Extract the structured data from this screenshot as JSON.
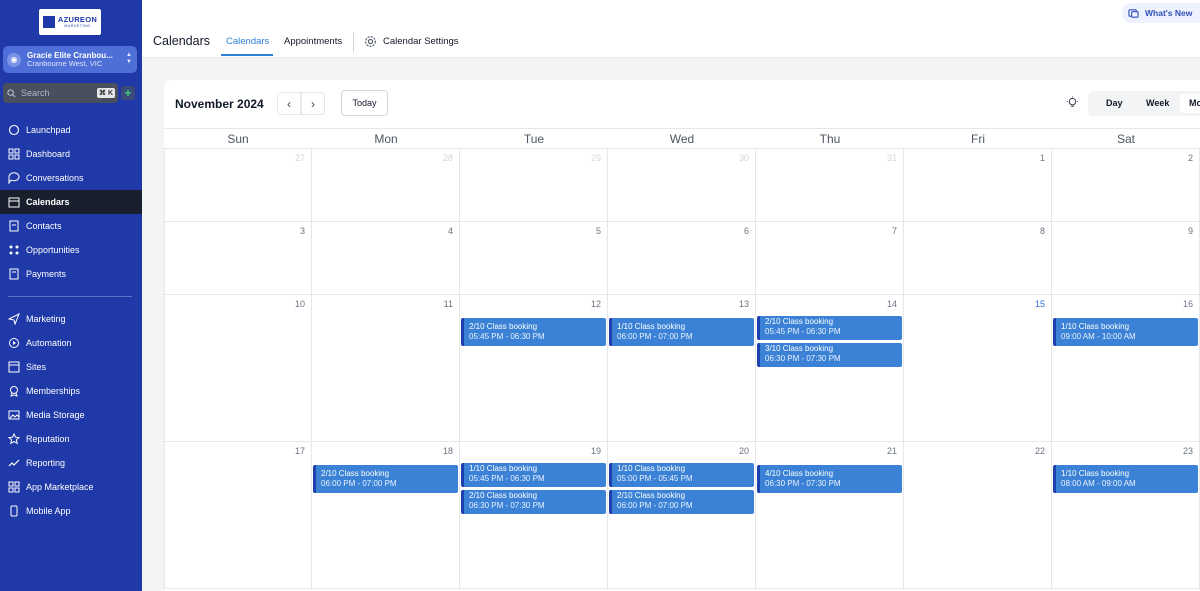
{
  "sidebar": {
    "logo": {
      "name": "AZUREON",
      "sub": "MARKETING"
    },
    "account": {
      "name": "Gracie Elite Cranbou...",
      "location": "Cranbourne West, VIC"
    },
    "search": {
      "placeholder": "Search",
      "shortcut": "⌘ K"
    },
    "nav_top": [
      "Launchpad",
      "Dashboard",
      "Conversations",
      "Calendars",
      "Contacts",
      "Opportunities",
      "Payments"
    ],
    "nav_bottom": [
      "Marketing",
      "Automation",
      "Sites",
      "Memberships",
      "Media Storage",
      "Reputation",
      "Reporting",
      "App Marketplace",
      "Mobile App"
    ],
    "active": "Calendars"
  },
  "topbar": {
    "title": "Calendars",
    "tabs": [
      "Calendars",
      "Appointments",
      "Calendar Settings"
    ],
    "active_tab": "Calendars",
    "whats_new": "What's New"
  },
  "calendar": {
    "month_label": "November 2024",
    "today_button": "Today",
    "views": [
      "Day",
      "Week",
      "Mo"
    ],
    "active_view": "Mo",
    "weekdays": [
      "Sun",
      "Mon",
      "Tue",
      "Wed",
      "Thu",
      "Fri",
      "Sat"
    ],
    "weeks": [
      [
        {
          "d": "27",
          "muted": true
        },
        {
          "d": "28",
          "muted": true
        },
        {
          "d": "29",
          "muted": true
        },
        {
          "d": "30",
          "muted": true
        },
        {
          "d": "31",
          "muted": true
        },
        {
          "d": "1"
        },
        {
          "d": "2"
        }
      ],
      [
        {
          "d": "3"
        },
        {
          "d": "4"
        },
        {
          "d": "5"
        },
        {
          "d": "6"
        },
        {
          "d": "7"
        },
        {
          "d": "8"
        },
        {
          "d": "9"
        }
      ],
      [
        {
          "d": "10"
        },
        {
          "d": "11"
        },
        {
          "d": "12"
        },
        {
          "d": "13"
        },
        {
          "d": "14"
        },
        {
          "d": "15",
          "today": true
        },
        {
          "d": "16"
        }
      ],
      [
        {
          "d": "17"
        },
        {
          "d": "18"
        },
        {
          "d": "19"
        },
        {
          "d": "20"
        },
        {
          "d": "21"
        },
        {
          "d": "22"
        },
        {
          "d": "23"
        }
      ]
    ],
    "events": [
      {
        "week": 2,
        "day": 2,
        "slot": 0,
        "title": "2/10  Class booking",
        "time": "05:45 PM - 06:30 PM"
      },
      {
        "week": 2,
        "day": 3,
        "slot": 0,
        "title": "1/10  Class booking",
        "time": "06:00 PM - 07:00 PM"
      },
      {
        "week": 2,
        "day": 4,
        "slot": 0,
        "title": "2/10  Class booking",
        "time": "05:45 PM - 06:30 PM"
      },
      {
        "week": 2,
        "day": 4,
        "slot": 1,
        "title": "3/10  Class booking",
        "time": "06:30 PM - 07:30 PM"
      },
      {
        "week": 2,
        "day": 6,
        "slot": 0,
        "title": "1/10  Class booking",
        "time": "09:00 AM - 10:00 AM"
      },
      {
        "week": 3,
        "day": 1,
        "slot": 0,
        "title": "2/10  Class booking",
        "time": "06:00 PM - 07:00 PM"
      },
      {
        "week": 3,
        "day": 2,
        "slot": 0,
        "title": "1/10  Class booking",
        "time": "05:45 PM - 06:30 PM"
      },
      {
        "week": 3,
        "day": 2,
        "slot": 1,
        "title": "2/10  Class booking",
        "time": "06:30 PM - 07:30 PM"
      },
      {
        "week": 3,
        "day": 3,
        "slot": 0,
        "title": "1/10  Class booking",
        "time": "05:00 PM - 05:45 PM"
      },
      {
        "week": 3,
        "day": 3,
        "slot": 1,
        "title": "2/10  Class booking",
        "time": "06:00 PM - 07:00 PM"
      },
      {
        "week": 3,
        "day": 4,
        "slot": 0,
        "title": "4/10  Class booking",
        "time": "06:30 PM - 07:30 PM"
      },
      {
        "week": 3,
        "day": 6,
        "slot": 0,
        "title": "1/10  Class booking",
        "time": "08:00 AM - 09:00 AM"
      }
    ]
  }
}
